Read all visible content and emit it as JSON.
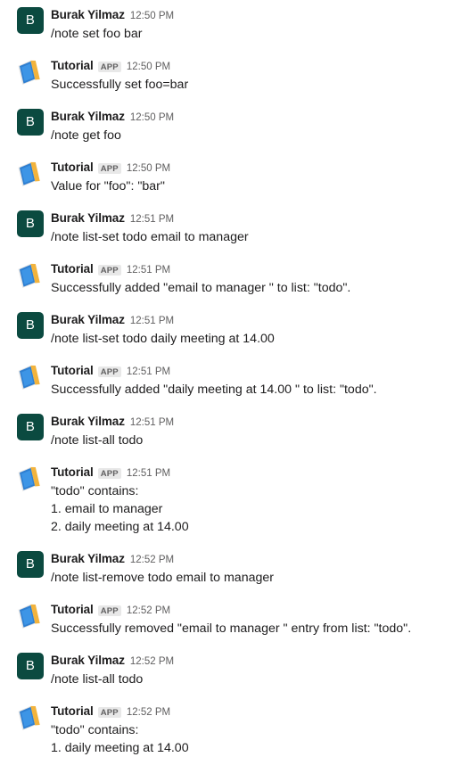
{
  "app": {
    "name": "slack-message-list",
    "background_color": "#ffffff",
    "text_color": "#1d1c1d",
    "meta_color": "#616061",
    "user_avatar_color": "#0b4a40",
    "app_badge_bg": "#e8e8e8"
  },
  "authors": {
    "user": {
      "name": "Burak Yilmaz",
      "initial": "B",
      "avatar_icon": "user-initial-avatar"
    },
    "bot": {
      "name": "Tutorial",
      "badge": "APP",
      "avatar_icon": "notebook-icon"
    }
  },
  "messages": [
    {
      "author": "Burak Yilmaz",
      "kind": "user",
      "initial": "B",
      "badge": "",
      "time": "12:50 PM",
      "lines": [
        "/note set foo bar"
      ]
    },
    {
      "author": "Tutorial",
      "kind": "bot",
      "initial": "",
      "badge": "APP",
      "time": "12:50 PM",
      "lines": [
        "Successfully set foo=bar"
      ]
    },
    {
      "author": "Burak Yilmaz",
      "kind": "user",
      "initial": "B",
      "badge": "",
      "time": "12:50 PM",
      "lines": [
        "/note get foo"
      ]
    },
    {
      "author": "Tutorial",
      "kind": "bot",
      "initial": "",
      "badge": "APP",
      "time": "12:50 PM",
      "lines": [
        "Value for \"foo\": \"bar\""
      ]
    },
    {
      "author": "Burak Yilmaz",
      "kind": "user",
      "initial": "B",
      "badge": "",
      "time": "12:51 PM",
      "lines": [
        "/note list-set todo email to manager"
      ]
    },
    {
      "author": "Tutorial",
      "kind": "bot",
      "initial": "",
      "badge": "APP",
      "time": "12:51 PM",
      "lines": [
        "Successfully added \"email to manager \" to list: \"todo\"."
      ]
    },
    {
      "author": "Burak Yilmaz",
      "kind": "user",
      "initial": "B",
      "badge": "",
      "time": "12:51 PM",
      "lines": [
        "/note list-set todo daily meeting at 14.00"
      ]
    },
    {
      "author": "Tutorial",
      "kind": "bot",
      "initial": "",
      "badge": "APP",
      "time": "12:51 PM",
      "lines": [
        "Successfully added \"daily meeting at 14.00 \" to list: \"todo\"."
      ]
    },
    {
      "author": "Burak Yilmaz",
      "kind": "user",
      "initial": "B",
      "badge": "",
      "time": "12:51 PM",
      "lines": [
        "/note list-all todo"
      ]
    },
    {
      "author": "Tutorial",
      "kind": "bot",
      "initial": "",
      "badge": "APP",
      "time": "12:51 PM",
      "lines": [
        "\"todo\" contains:",
        "1. email to manager",
        "2. daily meeting at 14.00"
      ]
    },
    {
      "author": "Burak Yilmaz",
      "kind": "user",
      "initial": "B",
      "badge": "",
      "time": "12:52 PM",
      "lines": [
        "/note list-remove todo email to manager"
      ]
    },
    {
      "author": "Tutorial",
      "kind": "bot",
      "initial": "",
      "badge": "APP",
      "time": "12:52 PM",
      "lines": [
        "Successfully removed \"email to manager \" entry from list: \"todo\"."
      ]
    },
    {
      "author": "Burak Yilmaz",
      "kind": "user",
      "initial": "B",
      "badge": "",
      "time": "12:52 PM",
      "lines": [
        "/note list-all todo"
      ]
    },
    {
      "author": "Tutorial",
      "kind": "bot",
      "initial": "",
      "badge": "APP",
      "time": "12:52 PM",
      "lines": [
        "\"todo\" contains:",
        "1. daily meeting at 14.00"
      ]
    }
  ]
}
